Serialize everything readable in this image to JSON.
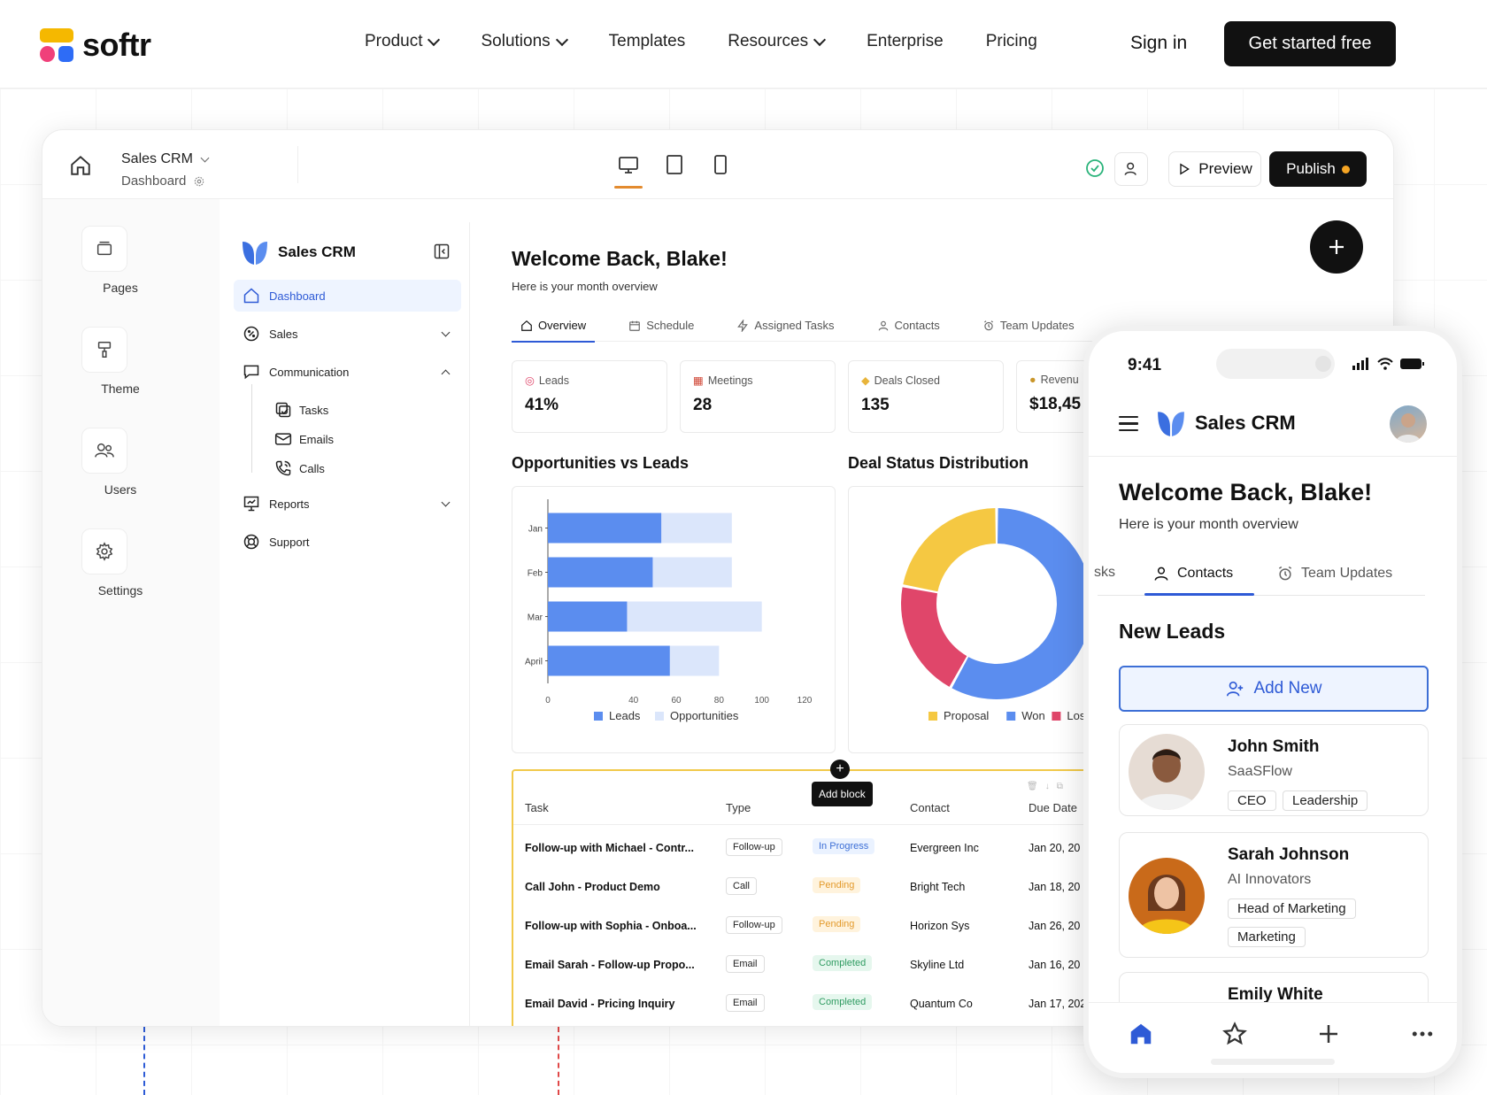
{
  "site": {
    "logo_text": "softr",
    "nav": [
      {
        "label": "Product",
        "dropdown": true
      },
      {
        "label": "Solutions",
        "dropdown": true
      },
      {
        "label": "Templates",
        "dropdown": false
      },
      {
        "label": "Resources",
        "dropdown": true
      },
      {
        "label": "Enterprise",
        "dropdown": false
      },
      {
        "label": "Pricing",
        "dropdown": false
      }
    ],
    "sign_in": "Sign in",
    "cta": "Get started free"
  },
  "builder": {
    "app_name": "Sales CRM",
    "page_name": "Dashboard",
    "preview": "Preview",
    "publish": "Publish",
    "rail": [
      {
        "label": "Pages",
        "icon": "pages-icon"
      },
      {
        "label": "Theme",
        "icon": "paint-roller-icon"
      },
      {
        "label": "Users",
        "icon": "users-icon"
      },
      {
        "label": "Settings",
        "icon": "gear-icon"
      }
    ]
  },
  "app": {
    "brand": "Sales CRM",
    "sidebar": {
      "dashboard": "Dashboard",
      "sales": "Sales",
      "communication": "Communication",
      "tasks": "Tasks",
      "emails": "Emails",
      "calls": "Calls",
      "reports": "Reports",
      "support": "Support"
    },
    "welcome": "Welcome Back, Blake!",
    "subtitle": "Here is your month overview",
    "tabs": [
      "Overview",
      "Schedule",
      "Assigned Tasks",
      "Contacts",
      "Team Updates"
    ],
    "stats": [
      {
        "label": "Leads",
        "value": "41%"
      },
      {
        "label": "Meetings",
        "value": "28"
      },
      {
        "label": "Deals Closed",
        "value": "135"
      },
      {
        "label": "Revenu",
        "value": "$18,45"
      }
    ],
    "bar_title": "Opportunities vs Leads",
    "donut_title": "Deal Status Distribution",
    "table": {
      "headers": [
        "Task",
        "Type",
        "",
        "Contact",
        "Due Date"
      ],
      "rows": [
        {
          "task": "Follow-up with Michael - Contr...",
          "type": "Follow-up",
          "status": "In Progress",
          "status_kind": "inprogress",
          "contact": "Evergreen Inc",
          "due": "Jan 20, 20"
        },
        {
          "task": "Call John - Product Demo",
          "type": "Call",
          "status": "Pending",
          "status_kind": "pending",
          "contact": "Bright Tech",
          "due": "Jan 18, 20"
        },
        {
          "task": "Follow-up with Sophia - Onboa...",
          "type": "Follow-up",
          "status": "Pending",
          "status_kind": "pending",
          "contact": "Horizon Sys",
          "due": "Jan 26, 20"
        },
        {
          "task": "Email Sarah - Follow-up Propo...",
          "type": "Email",
          "status": "Completed",
          "status_kind": "completed",
          "contact": "Skyline Ltd",
          "due": "Jan 16, 20"
        },
        {
          "task": "Email David - Pricing Inquiry",
          "type": "Email",
          "status": "Completed",
          "status_kind": "completed",
          "contact": "Quantum Co",
          "due": "Jan 17, 202"
        }
      ]
    },
    "add_block": "Add block"
  },
  "chart_data": [
    {
      "type": "bar",
      "orientation": "horizontal",
      "categories": [
        "Jan",
        "Feb",
        "Mar",
        "April"
      ],
      "series": [
        {
          "name": "Leads",
          "values": [
            53,
            49,
            37,
            57
          ],
          "color": "#5b8def"
        },
        {
          "name": "Opportunities",
          "values": [
            86,
            86,
            100,
            80
          ],
          "color": "#dbe6fb"
        }
      ],
      "xlim": [
        0,
        120
      ],
      "xticks": [
        0,
        40,
        60,
        80,
        100,
        120
      ],
      "legend": "bottom"
    },
    {
      "type": "pie",
      "donut": true,
      "categories": [
        "Proposal",
        "Won",
        "Los"
      ],
      "values": [
        22,
        58,
        20
      ],
      "colors": [
        "#f5c842",
        "#5b8def",
        "#e0466a"
      ],
      "legend": "bottom"
    }
  ],
  "phone": {
    "time": "9:41",
    "brand": "Sales CRM",
    "welcome": "Welcome Back, Blake!",
    "subtitle": "Here is your month overview",
    "tab_partial": "sks",
    "tab_contacts": "Contacts",
    "tab_team": "Team Updates",
    "new_leads": "New Leads",
    "add_new": "Add New",
    "leads": [
      {
        "name": "John Smith",
        "company": "SaaSFlow",
        "tags": [
          "CEO",
          "Leadership"
        ]
      },
      {
        "name": "Sarah Johnson",
        "company": "AI Innovators",
        "tags": [
          "Head of Marketing",
          "Marketing"
        ]
      },
      {
        "name": "Emily White",
        "company": "",
        "tags": []
      }
    ]
  },
  "colors": {
    "accent": "#2e5ad6",
    "dark": "#111111",
    "publish_dot": "#f5a524",
    "table_highlight": "#f1c94a"
  }
}
